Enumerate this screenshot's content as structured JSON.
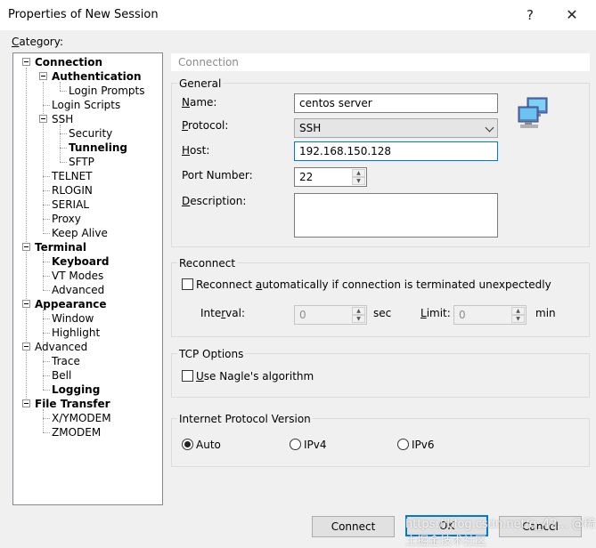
{
  "window": {
    "title": "Properties of New Session",
    "help": "?",
    "close": "✕"
  },
  "category_label": {
    "c": "C",
    "rest": "ategory:"
  },
  "tree": [
    {
      "label": "Connection",
      "bold": true
    },
    {
      "label": "Authentication",
      "bold": true
    },
    {
      "label": "Login Prompts",
      "bold": false
    },
    {
      "label": "Login Scripts",
      "bold": false
    },
    {
      "label": "SSH",
      "bold": false
    },
    {
      "label": "Security",
      "bold": false
    },
    {
      "label": "Tunneling",
      "bold": true
    },
    {
      "label": "SFTP",
      "bold": false
    },
    {
      "label": "TELNET",
      "bold": false
    },
    {
      "label": "RLOGIN",
      "bold": false
    },
    {
      "label": "SERIAL",
      "bold": false
    },
    {
      "label": "Proxy",
      "bold": false
    },
    {
      "label": "Keep Alive",
      "bold": false
    },
    {
      "label": "Terminal",
      "bold": true
    },
    {
      "label": "Keyboard",
      "bold": true
    },
    {
      "label": "VT Modes",
      "bold": false
    },
    {
      "label": "Advanced",
      "bold": false
    },
    {
      "label": "Appearance",
      "bold": true
    },
    {
      "label": "Window",
      "bold": false
    },
    {
      "label": "Highlight",
      "bold": false
    },
    {
      "label": "Advanced",
      "bold": false
    },
    {
      "label": "Trace",
      "bold": false
    },
    {
      "label": "Bell",
      "bold": false
    },
    {
      "label": "Logging",
      "bold": true
    },
    {
      "label": "File Transfer",
      "bold": true
    },
    {
      "label": "X/YMODEM",
      "bold": false
    },
    {
      "label": "ZMODEM",
      "bold": false
    }
  ],
  "panel_title": "Connection",
  "general": {
    "title": "General",
    "name_label": {
      "u": "N",
      "rest": "ame:"
    },
    "name_value": "centos server",
    "protocol_label": {
      "u": "P",
      "rest": "rotocol:"
    },
    "protocol_value": "SSH",
    "host_label": {
      "u": "H",
      "rest": "ost:"
    },
    "host_value": "192.168.150.128",
    "port_label": {
      "u": "",
      "rest": "Port Number:"
    },
    "port_value": "22",
    "desc_label": {
      "u": "D",
      "rest": "escription:"
    },
    "desc_value": ""
  },
  "reconnect": {
    "title": "Reconnect",
    "auto_label_pre": "Reconnect ",
    "auto_label_u": "a",
    "auto_label_post": "utomatically if connection is terminated unexpectedly",
    "auto_checked": false,
    "interval_label_pre": "Inte",
    "interval_label_u": "r",
    "interval_label_post": "val:",
    "interval_value": "0",
    "interval_unit": "sec",
    "limit_label_pre": "",
    "limit_label_u": "L",
    "limit_label_post": "imit:",
    "limit_value": "0",
    "limit_unit": "min"
  },
  "tcp": {
    "title": "TCP Options",
    "nagle_u": "U",
    "nagle_rest": "se Nagle's algorithm",
    "nagle_checked": false
  },
  "ipver": {
    "title": "Internet Protocol Version",
    "options": [
      "Auto",
      "IPv4",
      "IPv6"
    ],
    "selected": "Auto"
  },
  "buttons": {
    "connect": "Connect",
    "ok": "OK",
    "cancel": "Cancel"
  },
  "watermark": "https://blog.csdn.net/q_42... @稀土掘金技术社区"
}
